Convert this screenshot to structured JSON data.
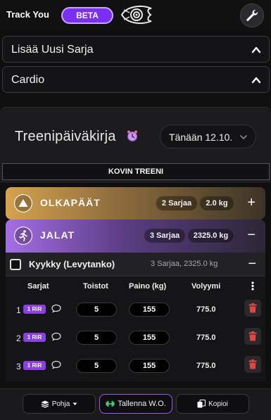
{
  "header": {
    "brand": "Track You",
    "beta": "BETA",
    "logo_icon": "eye-logo-icon",
    "settings_icon": "wrench-icon"
  },
  "accordions": [
    {
      "label": "Lisää Uusi Sarja",
      "icon": "chevron-up-icon"
    },
    {
      "label": "Cardio",
      "icon": "chevron-up-icon"
    }
  ],
  "diary": {
    "title": "Treenipäiväkirja",
    "date": "Tänään 12.10.",
    "best_label": "KOVIN TREENI"
  },
  "groups": [
    {
      "name": "OLKAPÄÄT",
      "sets": "2 Sarjaa",
      "weight": "2.0 kg",
      "toggle": "+",
      "color": "#d6a34f"
    },
    {
      "name": "JALAT",
      "sets": "3 Sarjaa",
      "weight": "2325.0 kg",
      "toggle": "−",
      "color": "#a56ee6"
    }
  ],
  "exercise": {
    "name": "Kyykky (Levytanko)",
    "meta": "3 Sarjaa, 2325.0 kg",
    "toggle": "−"
  },
  "table": {
    "headers": [
      "Sarjat",
      "Toistot",
      "Paino (kg)",
      "Volyymi"
    ],
    "rows": [
      {
        "set": "1",
        "rir": "1 RiR",
        "reps": "5",
        "weight": "155",
        "volume": "775.0"
      },
      {
        "set": "2",
        "rir": "1 RiR",
        "reps": "5",
        "weight": "155",
        "volume": "775.0"
      },
      {
        "set": "3",
        "rir": "1 RiR",
        "reps": "5",
        "weight": "155",
        "volume": "775.0"
      }
    ]
  },
  "bottom": {
    "template": "Pohja",
    "save": "Tallenna W.O.",
    "copy": "Kopioi"
  },
  "colors": {
    "accent": "#7b2ff2",
    "delete": "#e0453f"
  }
}
